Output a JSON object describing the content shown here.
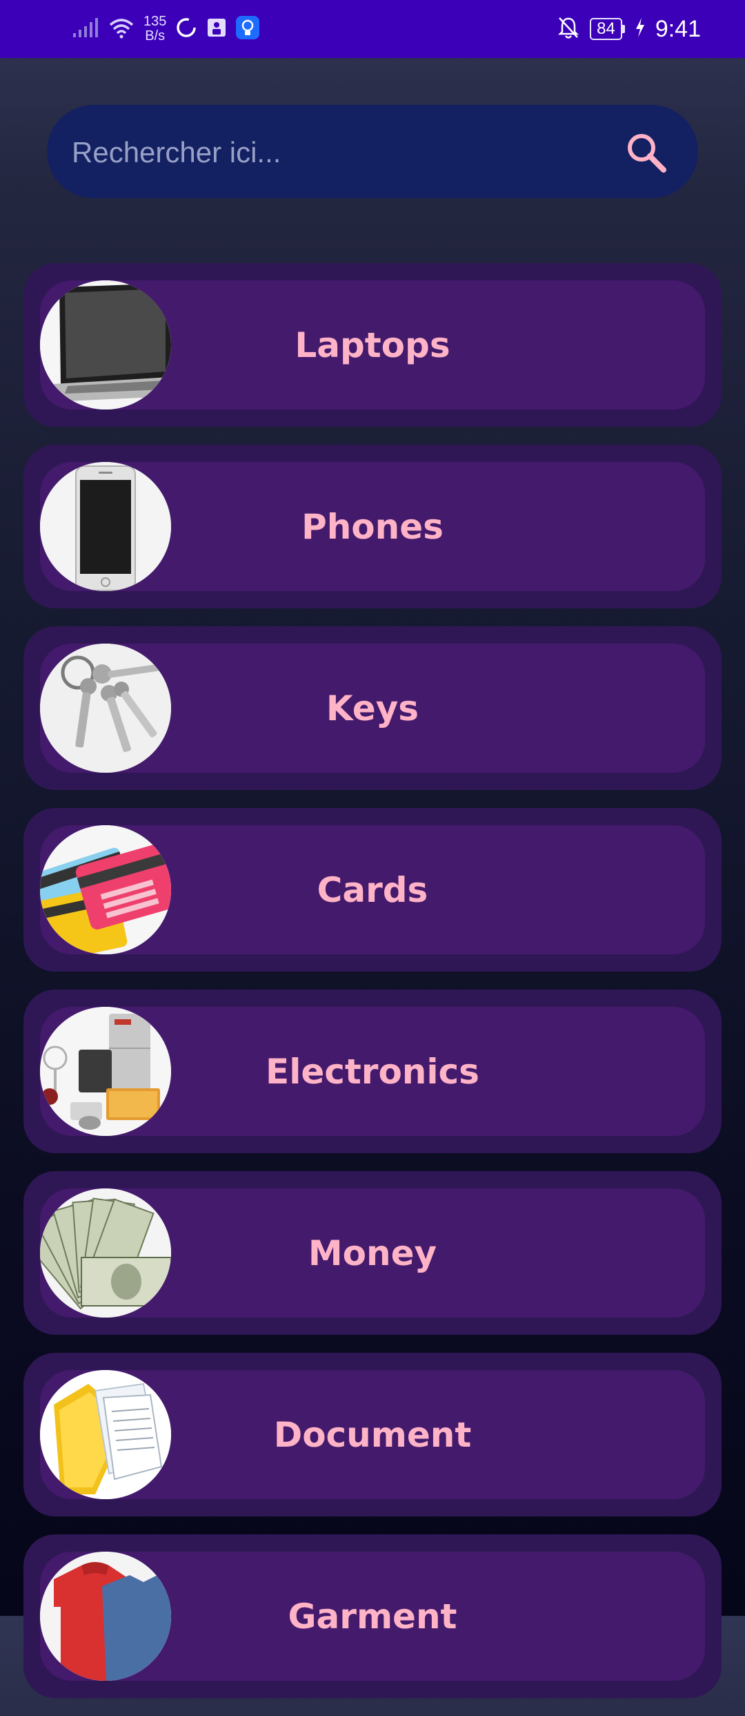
{
  "status_bar": {
    "speed_value": "135",
    "speed_unit": "B/s",
    "battery_level": "84",
    "time": "9:41"
  },
  "search": {
    "placeholder": "Rechercher ici...",
    "value": ""
  },
  "categories": [
    {
      "label": "Laptops",
      "icon": "laptop-icon"
    },
    {
      "label": "Phones",
      "icon": "phone-icon"
    },
    {
      "label": "Keys",
      "icon": "keys-icon"
    },
    {
      "label": "Cards",
      "icon": "cards-icon"
    },
    {
      "label": "Electronics",
      "icon": "electronics-icon"
    },
    {
      "label": "Money",
      "icon": "money-icon"
    },
    {
      "label": "Document",
      "icon": "document-icon"
    },
    {
      "label": "Garment",
      "icon": "garment-icon"
    }
  ],
  "colors": {
    "status_bar": "#3b00b8",
    "search_background": "#132062",
    "card_outer": "#2f1755",
    "card_inner": "#441a6c",
    "label_text": "#ffb3c7",
    "search_icon": "#ffb3c7"
  }
}
